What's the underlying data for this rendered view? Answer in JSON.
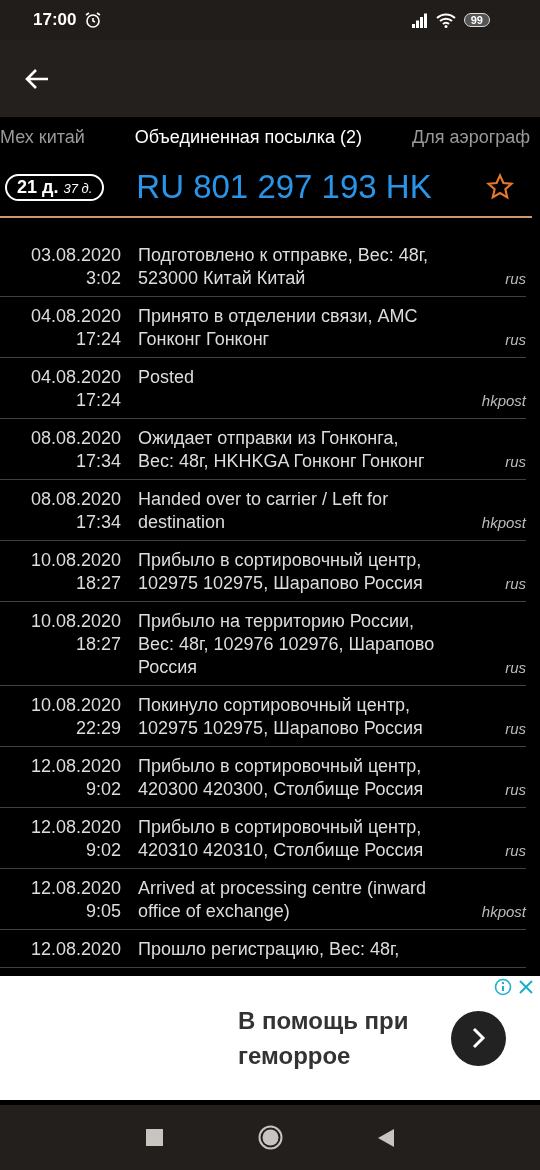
{
  "status_bar": {
    "time": "17:00",
    "battery": "99"
  },
  "tabs": [
    {
      "label": "Мех китай",
      "selected": false
    },
    {
      "label": "Объединенная посылка (2)",
      "selected": true
    },
    {
      "label": "Для аэрограф",
      "selected": false
    }
  ],
  "parcel": {
    "days": "21 д.",
    "total_days": "37 д.",
    "track": "RU 801 297 193 HK",
    "starred": false
  },
  "events": [
    {
      "date": "03.08.2020",
      "time": "3:02",
      "text": "Подготовлено к отправке, Вес: 48г,\n523000 Китай Китай",
      "source": "rus"
    },
    {
      "date": "04.08.2020",
      "time": "17:24",
      "text": "Принято в отделении связи, АМС\nГонконг Гонконг",
      "source": "rus"
    },
    {
      "date": "04.08.2020",
      "time": "17:24",
      "text": "Posted",
      "source": "hkpost"
    },
    {
      "date": "08.08.2020",
      "time": "17:34",
      "text": "Ожидает отправки из Гонконга,\nВес: 48г, HKHKGA Гонконг Гонконг",
      "source": "rus"
    },
    {
      "date": "08.08.2020",
      "time": "17:34",
      "text": "Handed over to carrier / Left for\ndestination",
      "source": "hkpost"
    },
    {
      "date": "10.08.2020",
      "time": "18:27",
      "text": "Прибыло в сортировочный центр,\n102975 102975, Шарапово Россия",
      "source": "rus"
    },
    {
      "date": "10.08.2020",
      "time": "18:27",
      "text": "Прибыло на территорию России,\nВес: 48г, 102976 102976, Шарапово\nРоссия",
      "source": "rus"
    },
    {
      "date": "10.08.2020",
      "time": "22:29",
      "text": "Покинуло сортировочный центр,\n102975 102975, Шарапово Россия",
      "source": "rus"
    },
    {
      "date": "12.08.2020",
      "time": "9:02",
      "text": "Прибыло в сортировочный центр,\n420300 420300, Столбище Россия",
      "source": "rus"
    },
    {
      "date": "12.08.2020",
      "time": "9:02",
      "text": "Прибыло в сортировочный центр,\n420310 420310, Столбище Россия",
      "source": "rus"
    },
    {
      "date": "12.08.2020",
      "time": "9:05",
      "text": "Arrived at processing centre (inward\noffice of exchange)",
      "source": "hkpost"
    },
    {
      "date": "12.08.2020",
      "text": "Прошло регистрацию, Вес: 48г,"
    }
  ],
  "ad": {
    "text": "В помощь при\nгеморрое"
  }
}
